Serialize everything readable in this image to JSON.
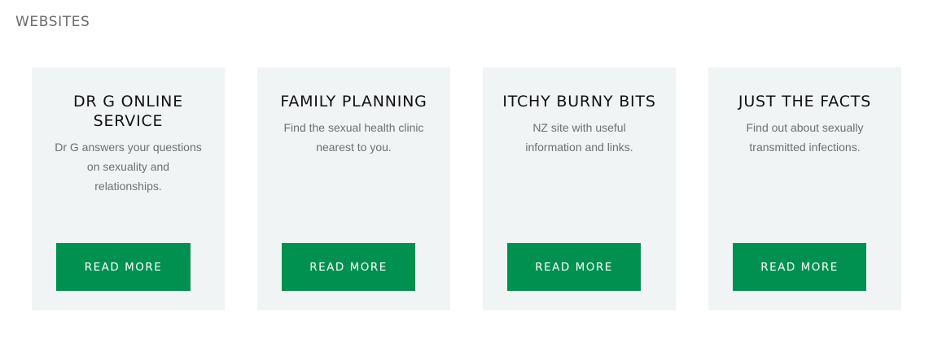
{
  "section": {
    "heading": "WEBSITES"
  },
  "cards": [
    {
      "title": "DR G ONLINE SERVICE",
      "description": "Dr G answers your questions on sexuality and relationships.",
      "button_label": "READ MORE"
    },
    {
      "title": "FAMILY PLANNING",
      "description": "Find the sexual health clinic nearest to you.",
      "button_label": "READ MORE"
    },
    {
      "title": "ITCHY BURNY BITS",
      "description": "NZ site with useful information and links.",
      "button_label": "READ MORE"
    },
    {
      "title": "JUST THE FACTS",
      "description": "Find out about sexually transmitted infections.",
      "button_label": "READ MORE"
    }
  ],
  "colors": {
    "accent_green": "#009150",
    "card_background": "#f1f4f4",
    "heading_gray": "#6b6b6b"
  }
}
